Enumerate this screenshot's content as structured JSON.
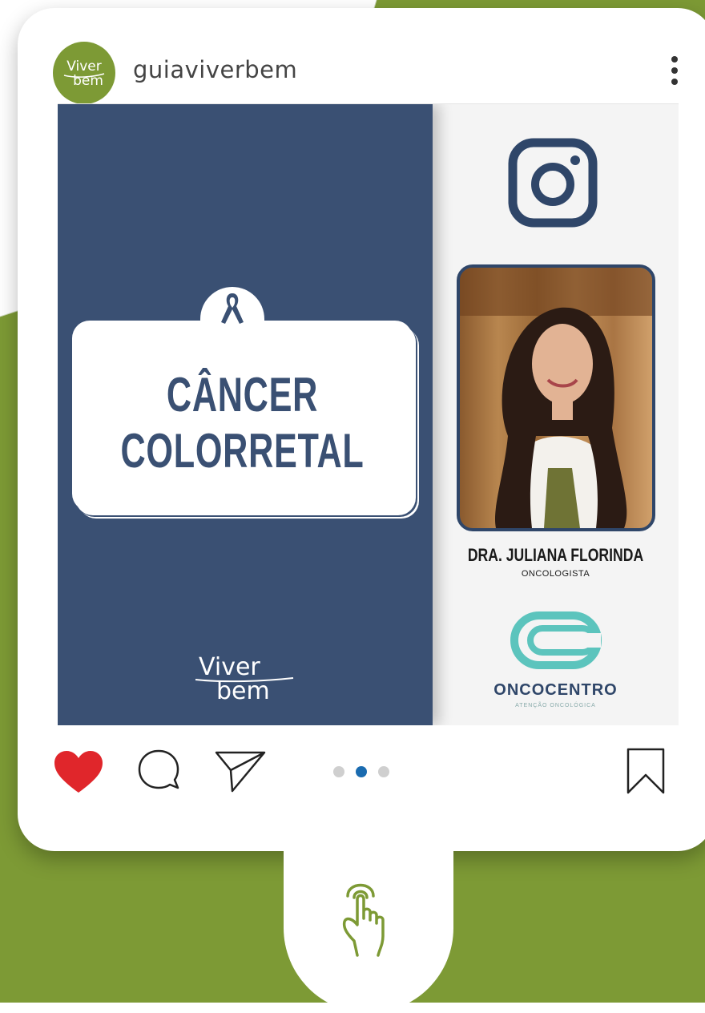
{
  "colors": {
    "green": "#7d9a35",
    "navy": "#3a5073",
    "teal": "#5cc4bd",
    "heart": "#e0262b",
    "active_dot": "#1a6bb0"
  },
  "header": {
    "avatar_text_top": "Viver",
    "avatar_text_bottom": "bem",
    "username": "guiaviverbem",
    "menu_icon": "more-vertical-icon"
  },
  "post": {
    "title_line1": "CÂNCER",
    "title_line2": "COLORRETAL",
    "brand_top": "Viver",
    "brand_bottom": "bem",
    "doctor_name": "DRA. JULIANA FLORINDA",
    "doctor_role": "ONCOLOGISTA",
    "clinic_name": "ONCOCENTRO",
    "clinic_tagline": "ATENÇÃO ONCOLÓGICA"
  },
  "actions": {
    "like_icon": "heart-icon",
    "comment_icon": "comment-icon",
    "share_icon": "send-icon",
    "save_icon": "bookmark-icon",
    "carousel_active_index": 1,
    "carousel_count": 3
  },
  "swipe_hint": {
    "icon": "tap-hand-icon"
  }
}
